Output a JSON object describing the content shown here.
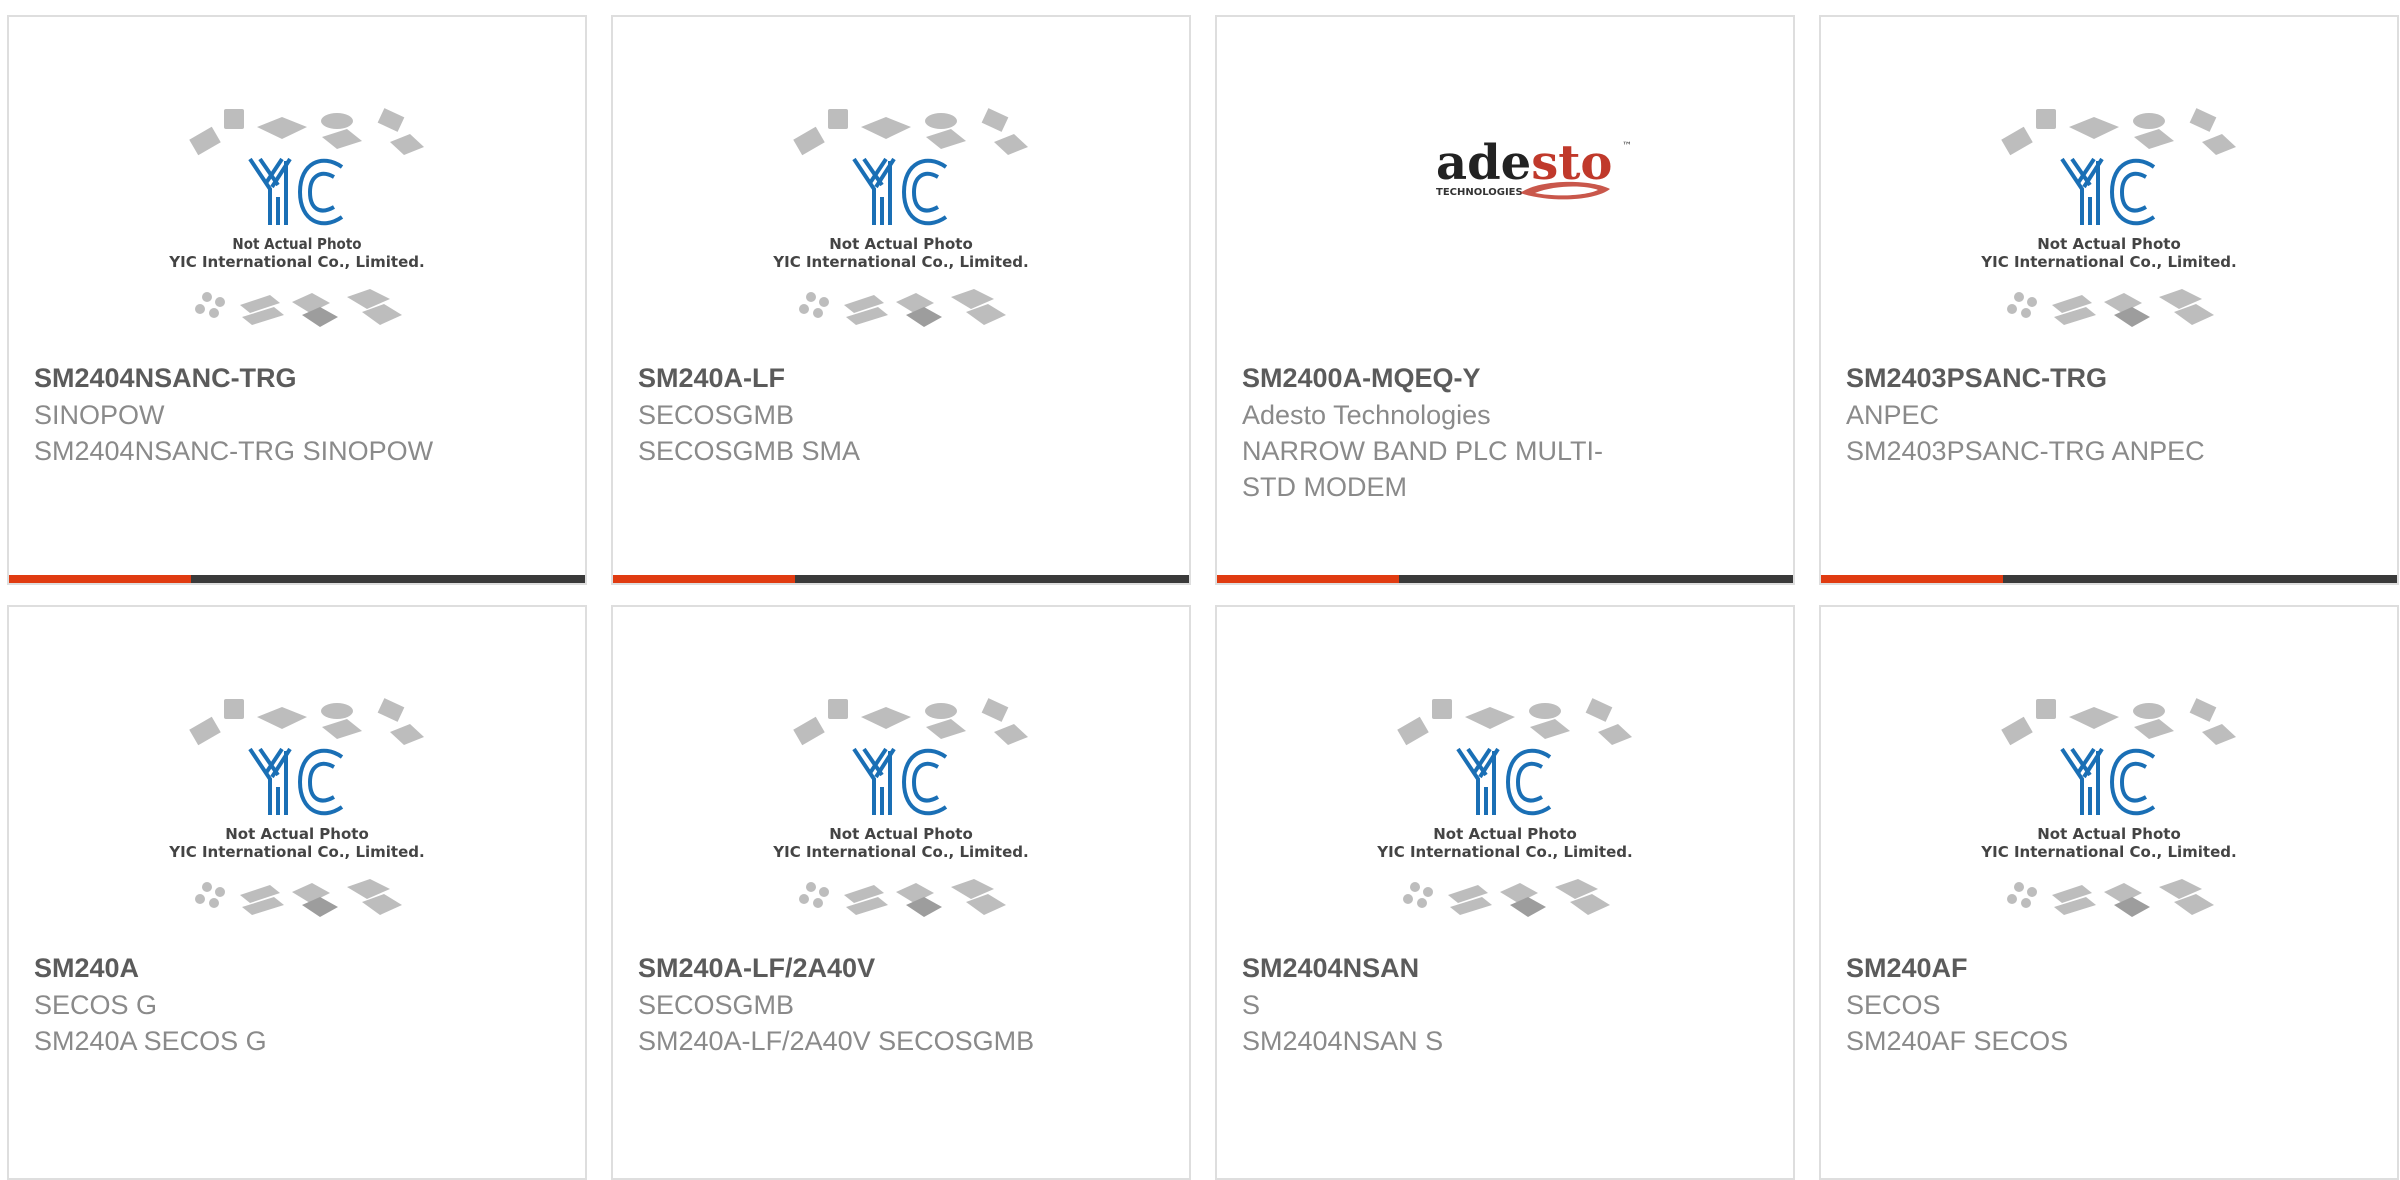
{
  "colors": {
    "accent": "#e03b11",
    "bar": "#3a3a3a",
    "yic_blue": "#1a6fb5",
    "adesto_red": "#c0392b"
  },
  "placeholder": {
    "line1": "Not Actual Photo",
    "line2": "YIC International Co., Limited."
  },
  "adesto": {
    "word_a": "ade",
    "word_b": "sto",
    "tm": "™",
    "sub": "TECHNOLOGIES"
  },
  "products": [
    {
      "pn": "SM2404NSANC-TRG",
      "mfr": "SINOPOW",
      "desc": "SM2404NSANC-TRG SINOPOW",
      "image": "yic-placeholder"
    },
    {
      "pn": "SM240A-LF",
      "mfr": "SECOSGMB",
      "desc": "SECOSGMB SMA",
      "image": "yic-placeholder"
    },
    {
      "pn": "SM2400A-MQEQ-Y",
      "mfr": "Adesto Technologies",
      "desc": "NARROW BAND PLC MULTI-STD MODEM",
      "image": "adesto-logo"
    },
    {
      "pn": "SM2403PSANC-TRG",
      "mfr": "ANPEC",
      "desc": "SM2403PSANC-TRG ANPEC",
      "image": "yic-placeholder"
    },
    {
      "pn": "SM240A",
      "mfr": "SECOS G",
      "desc": "SM240A SECOS G",
      "image": "yic-placeholder"
    },
    {
      "pn": "SM240A-LF/2A40V",
      "mfr": "SECOSGMB",
      "desc": "SM240A-LF/2A40V SECOSGMB",
      "image": "yic-placeholder"
    },
    {
      "pn": "SM2404NSAN",
      "mfr": "S",
      "desc": "SM2404NSAN S",
      "image": "yic-placeholder"
    },
    {
      "pn": "SM240AF",
      "mfr": "SECOS",
      "desc": "SM240AF SECOS",
      "image": "yic-placeholder"
    }
  ]
}
